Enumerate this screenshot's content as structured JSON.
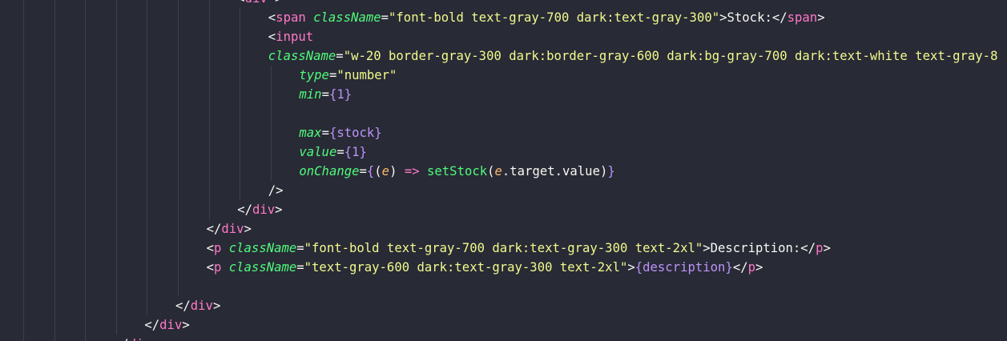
{
  "theme": {
    "background": "#282a36",
    "foreground": "#f8f8f2",
    "tag": "#ff79c6",
    "attribute": "#50fa7b",
    "string": "#f1fa8c",
    "brace": "#bd93f9",
    "parameter": "#ffb86c",
    "indent_guide": "#3c3f4f"
  },
  "code_lines": [
    {
      "indent": 7,
      "tokens": [
        [
          "p",
          "<"
        ],
        [
          "t",
          "div"
        ],
        [
          "p",
          " >"
        ]
      ]
    },
    {
      "indent": 8,
      "tokens": [
        [
          "p",
          "<"
        ],
        [
          "t",
          "span"
        ],
        [
          "p",
          " "
        ],
        [
          "a",
          "className"
        ],
        [
          "p",
          "="
        ],
        [
          "s",
          "\"font-bold text-gray-700 dark:text-gray-300\""
        ],
        [
          "p",
          ">Stock:</"
        ],
        [
          "t",
          "span"
        ],
        [
          "p",
          ">"
        ]
      ]
    },
    {
      "indent": 8,
      "tokens": [
        [
          "p",
          "<"
        ],
        [
          "t",
          "input"
        ]
      ]
    },
    {
      "indent": 8,
      "tokens": [
        [
          "a",
          "className"
        ],
        [
          "p",
          "="
        ],
        [
          "s",
          "\"w-20 border-gray-300 dark:border-gray-600 dark:bg-gray-700 dark:text-white text-gray-8"
        ]
      ]
    },
    {
      "indent": 9,
      "tokens": [
        [
          "a",
          "type"
        ],
        [
          "p",
          "="
        ],
        [
          "s",
          "\"number\""
        ]
      ]
    },
    {
      "indent": 9,
      "tokens": [
        [
          "a",
          "min"
        ],
        [
          "p",
          "="
        ],
        [
          "b",
          "{"
        ],
        [
          "n",
          "1"
        ],
        [
          "b",
          "}"
        ]
      ]
    },
    {
      "indent": 9,
      "tokens": []
    },
    {
      "indent": 9,
      "tokens": [
        [
          "a",
          "max"
        ],
        [
          "p",
          "="
        ],
        [
          "b",
          "{"
        ],
        [
          "v",
          "stock"
        ],
        [
          "b",
          "}"
        ]
      ]
    },
    {
      "indent": 9,
      "tokens": [
        [
          "a",
          "value"
        ],
        [
          "p",
          "="
        ],
        [
          "b",
          "{"
        ],
        [
          "n",
          "1"
        ],
        [
          "b",
          "}"
        ]
      ]
    },
    {
      "indent": 9,
      "tokens": [
        [
          "a",
          "onChange"
        ],
        [
          "p",
          "="
        ],
        [
          "b",
          "{"
        ],
        [
          "p",
          "("
        ],
        [
          "pa",
          "e"
        ],
        [
          "p",
          ")"
        ],
        [
          "p",
          " "
        ],
        [
          "o",
          "=>"
        ],
        [
          "p",
          " "
        ],
        [
          "f",
          "setStock"
        ],
        [
          "p",
          "("
        ],
        [
          "pa",
          "e"
        ],
        [
          "p",
          ".target.value)"
        ],
        [
          "b",
          "}"
        ]
      ]
    },
    {
      "indent": 8,
      "tokens": [
        [
          "p",
          "/>"
        ]
      ]
    },
    {
      "indent": 7,
      "tokens": [
        [
          "p",
          "</"
        ],
        [
          "t",
          "div"
        ],
        [
          "p",
          ">"
        ]
      ]
    },
    {
      "indent": 6,
      "tokens": [
        [
          "p",
          "</"
        ],
        [
          "t",
          "div"
        ],
        [
          "p",
          ">"
        ]
      ]
    },
    {
      "indent": 6,
      "tokens": [
        [
          "p",
          "<"
        ],
        [
          "t",
          "p"
        ],
        [
          "p",
          " "
        ],
        [
          "a",
          "className"
        ],
        [
          "p",
          "="
        ],
        [
          "s",
          "\"font-bold text-gray-700 dark:text-gray-300 text-2xl\""
        ],
        [
          "p",
          ">Description:</"
        ],
        [
          "t",
          "p"
        ],
        [
          "p",
          ">"
        ]
      ]
    },
    {
      "indent": 6,
      "tokens": [
        [
          "p",
          "<"
        ],
        [
          "t",
          "p"
        ],
        [
          "p",
          " "
        ],
        [
          "a",
          "className"
        ],
        [
          "p",
          "="
        ],
        [
          "s",
          "\"text-gray-600 dark:text-gray-300 text-2xl\""
        ],
        [
          "p",
          ">"
        ],
        [
          "b",
          "{"
        ],
        [
          "v",
          "description"
        ],
        [
          "b",
          "}"
        ],
        [
          "p",
          "</"
        ],
        [
          "t",
          "p"
        ],
        [
          "p",
          ">"
        ]
      ]
    },
    {
      "indent": 6,
      "tokens": []
    },
    {
      "indent": 5,
      "tokens": [
        [
          "p",
          "</"
        ],
        [
          "t",
          "div"
        ],
        [
          "p",
          ">"
        ]
      ]
    },
    {
      "indent": 4,
      "tokens": [
        [
          "p",
          "</"
        ],
        [
          "t",
          "div"
        ],
        [
          "p",
          ">"
        ]
      ]
    },
    {
      "indent": 3,
      "tokens": [
        [
          "p",
          "</"
        ],
        [
          "t",
          "div"
        ],
        [
          "p",
          ">"
        ]
      ]
    }
  ]
}
